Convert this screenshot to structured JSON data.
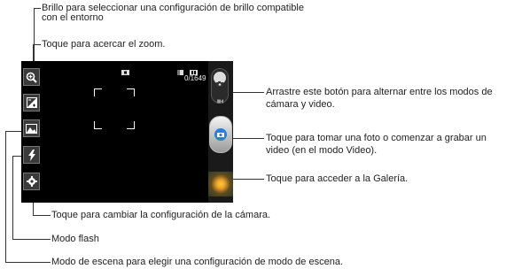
{
  "callouts": {
    "brightness_line1": "Brillo para seleccionar una configuración de brillo compatible",
    "brightness_line2": "con el entorno",
    "zoom": "Toque para acercar el zoom.",
    "mode_switch_line1": "Arrastre este botón para alternar entre los modos de",
    "mode_switch_line2": "cámara y video.",
    "shutter_line1": "Toque para tomar una foto o comenzar a grabar un",
    "shutter_line2": "video (en el modo Video).",
    "gallery": "Toque para acceder a la Galería.",
    "settings": "Toque para cambiar la configuración de la cámara.",
    "flash": "Modo flash",
    "scene": "Modo de escena para elegir una configuración de modo de escena."
  },
  "camera": {
    "photo_counter": "0/1649"
  },
  "icons": {
    "zoom": "zoom-in-icon",
    "brightness": "brightness-icon",
    "scene": "scene-mode-icon",
    "flash": "flash-icon",
    "settings": "gear-icon"
  },
  "colors": {
    "screen": "#000000",
    "shutter_accent": "#2d7fd3"
  }
}
